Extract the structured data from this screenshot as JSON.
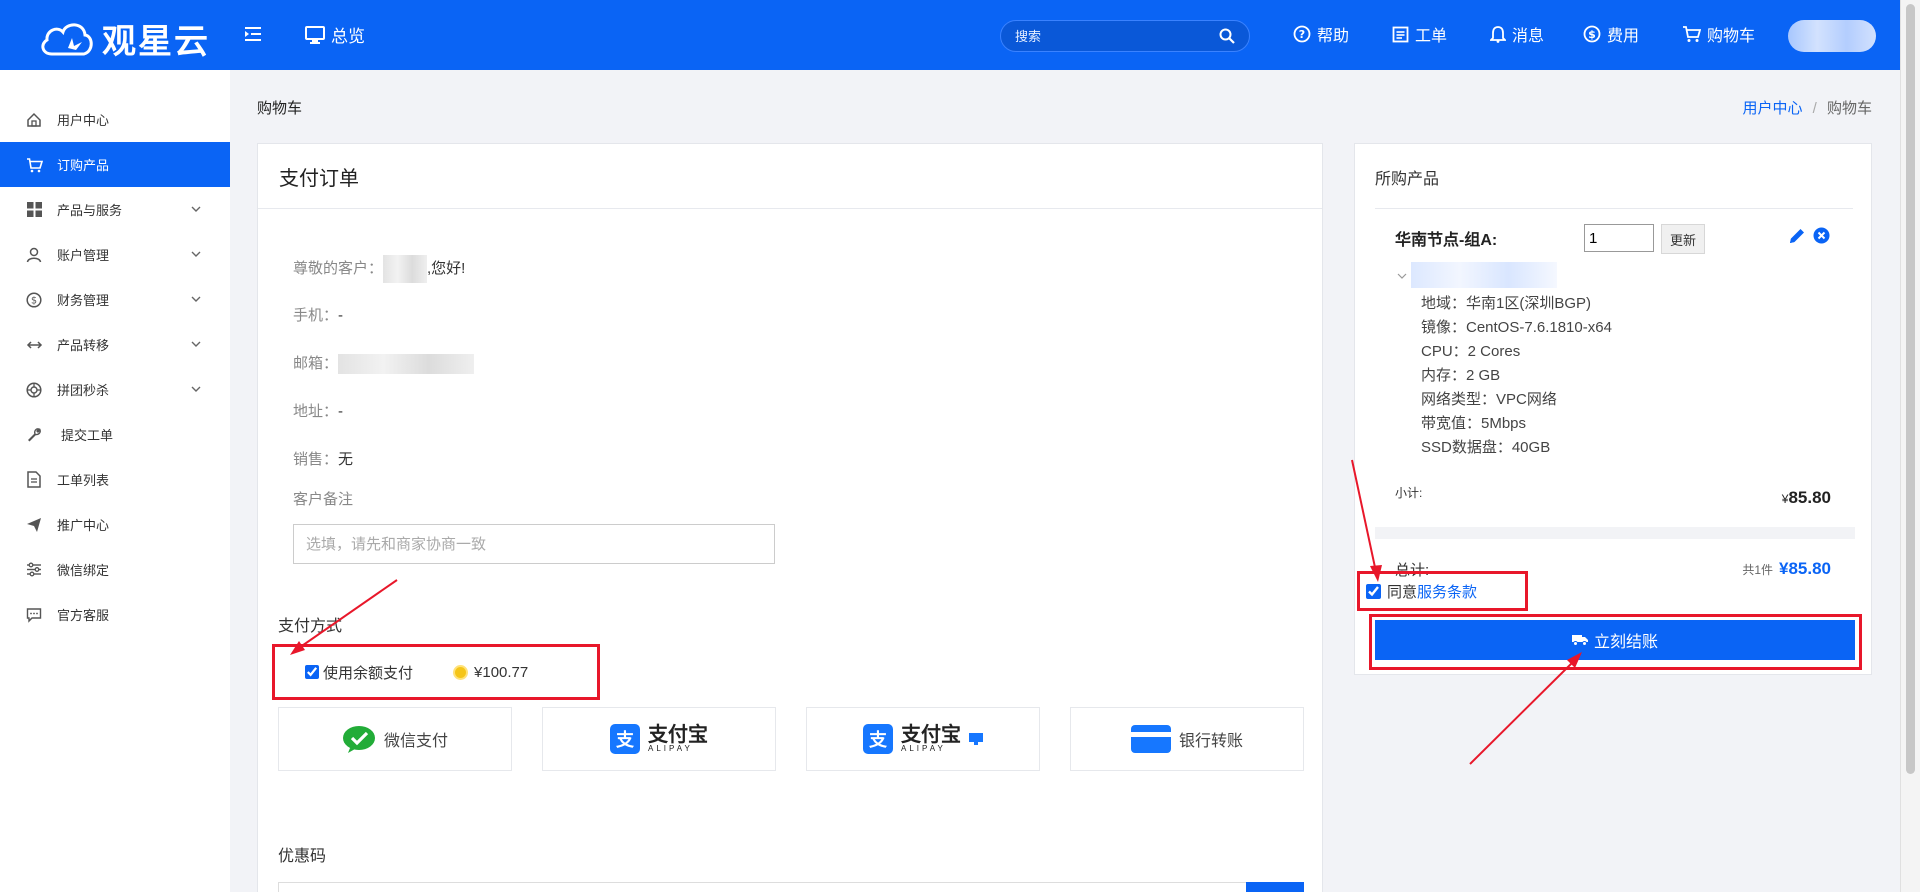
{
  "header": {
    "logo_text": "观星云",
    "overview_label": "总览",
    "search_placeholder": "搜索",
    "nav": [
      {
        "label": "帮助",
        "icon": "help-icon"
      },
      {
        "label": "工单",
        "icon": "ticket-icon"
      },
      {
        "label": "消息",
        "icon": "bell-icon"
      },
      {
        "label": "费用",
        "icon": "dollar-icon"
      },
      {
        "label": "购物车",
        "icon": "cart-icon"
      }
    ],
    "brand_color": "#0a64f5"
  },
  "sidebar": {
    "items": [
      {
        "label": "用户中心",
        "icon": "home-icon",
        "active": false,
        "expandable": false
      },
      {
        "label": "订购产品",
        "icon": "cart-icon",
        "active": true,
        "expandable": false
      },
      {
        "label": "产品与服务",
        "icon": "grid-icon",
        "active": false,
        "expandable": true
      },
      {
        "label": "账户管理",
        "icon": "user-icon",
        "active": false,
        "expandable": true
      },
      {
        "label": "财务管理",
        "icon": "dollar-icon",
        "active": false,
        "expandable": true
      },
      {
        "label": "产品转移",
        "icon": "transfer-icon",
        "active": false,
        "expandable": true
      },
      {
        "label": "拼团秒杀",
        "icon": "aperture-icon",
        "active": false,
        "expandable": true
      },
      {
        "label": "提交工单",
        "icon": "wrench-icon",
        "active": false,
        "expandable": false
      },
      {
        "label": "工单列表",
        "icon": "document-icon",
        "active": false,
        "expandable": false
      },
      {
        "label": "推广中心",
        "icon": "send-icon",
        "active": false,
        "expandable": false
      },
      {
        "label": "微信绑定",
        "icon": "sliders-icon",
        "active": false,
        "expandable": false
      },
      {
        "label": "官方客服",
        "icon": "chat-icon",
        "active": false,
        "expandable": false
      }
    ]
  },
  "page": {
    "title": "购物车",
    "breadcrumb": {
      "link": "用户中心",
      "separator": "/",
      "current": "购物车"
    }
  },
  "order": {
    "panel_title": "支付订单",
    "greeting_label": "尊敬的客户：",
    "greeting_suffix": ",您好!",
    "phone_label": "手机：",
    "phone_value": "-",
    "email_label": "邮箱：",
    "address_label": "地址：",
    "address_value": "-",
    "sales_label": "销售：",
    "sales_value": "无",
    "remark_label": "客户备注",
    "remark_placeholder": "选填，请先和商家协商一致",
    "payment_label": "支付方式",
    "balance_label": "使用余额支付",
    "balance_amount": "¥100.77",
    "balance_checked": true,
    "methods": [
      {
        "label": "微信支付",
        "icon": "wechat-pay-icon"
      },
      {
        "label": "支付宝",
        "sub": "ALIPAY",
        "icon": "alipay-icon"
      },
      {
        "label": "支付宝",
        "sub": "ALIPAY",
        "icon": "alipay-pc-icon"
      },
      {
        "label": "银行转账",
        "icon": "bank-card-icon"
      }
    ],
    "coupon_label": "优惠码"
  },
  "cart": {
    "title": "所购产品",
    "product_name": "华南节点-组A:",
    "quantity": "1",
    "update_label": "更新",
    "specs": [
      "地域：华南1区(深圳BGP)",
      "镜像：CentOS-7.6.1810-x64",
      "CPU：2 Cores",
      "内存：2 GB",
      "网络类型：VPC网络",
      "带宽值：5Mbps",
      "SSD数据盘：40GB"
    ],
    "subtotal_label": "小计:",
    "subtotal_currency": "¥",
    "subtotal_value": "85.80",
    "total_label": "总计:",
    "total_count": "共1件",
    "total_value": "¥85.80",
    "agree_prefix": "同意",
    "agree_link": "服务条款",
    "agree_checked": true,
    "checkout_label": "立刻结账"
  },
  "annotation_color": "#e8172a"
}
